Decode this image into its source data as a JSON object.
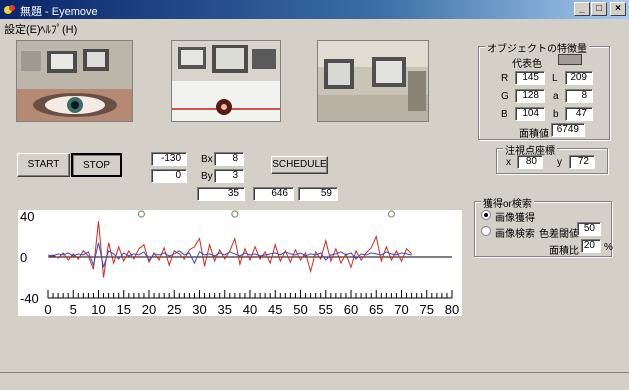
{
  "window": {
    "title": "無題 - Eyemove",
    "minimize": "_",
    "restore": "□",
    "close": "×"
  },
  "menu": [
    "設定(E)",
    "ﾍﾙﾌﾟ(H)"
  ],
  "controls": {
    "start_label": "START",
    "stop_label": "STOP",
    "schedule_label": "SCHEDULE",
    "field_a": "-130",
    "field_b": "0",
    "bx_label": "Bx",
    "bx_value": "8",
    "by_label": "By",
    "by_value": "3",
    "row_values": [
      "35",
      "646",
      "59"
    ]
  },
  "features": {
    "legend": "オブジェクトの特徴量",
    "rep_color_label": "代表色",
    "rep_color": "#a39d96",
    "rows": [
      {
        "k1": "R",
        "v1": "145",
        "k2": "L",
        "v2": "209"
      },
      {
        "k1": "G",
        "v1": "128",
        "k2": "a",
        "v2": "8"
      },
      {
        "k1": "B",
        "v1": "104",
        "k2": "b",
        "v2": "47"
      }
    ],
    "area_label": "面積値",
    "area_value": "6749"
  },
  "gaze": {
    "legend": "注視点座標",
    "x_label": "x",
    "x_value": "80",
    "y_label": "y",
    "y_value": "72"
  },
  "acquire": {
    "legend": "獲得or検索",
    "opt_acquire": "画像獲得",
    "opt_search": "画像検索",
    "threshold_label": "色差閾値",
    "threshold_value": "50",
    "ratio_label": "面積比",
    "ratio_value": "20",
    "ratio_unit": "%",
    "selected": "画像獲得"
  },
  "colors": {
    "red_series": "#d42a1a",
    "blue_series": "#3a48c8",
    "marker": "#6f9f6a"
  },
  "chart_data": {
    "type": "line",
    "title": "",
    "xlabel": "",
    "ylabel": "",
    "xlim": [
      0,
      80
    ],
    "ylim": [
      -40,
      40
    ],
    "y_ticks": [
      "40",
      "0",
      "-40"
    ],
    "x_ticks": [
      "0",
      "5",
      "10",
      "15",
      "20",
      "25",
      "30",
      "35",
      "40",
      "45",
      "50",
      "55",
      "60",
      "65",
      "70",
      "75",
      "80"
    ],
    "grid": false,
    "markers_x": [
      18.5,
      37,
      68
    ],
    "series": [
      {
        "color": "red",
        "x": [
          0,
          1,
          2,
          3,
          4,
          5,
          6,
          7,
          8,
          9,
          10,
          11,
          12,
          13,
          14,
          15,
          16,
          17,
          18,
          19,
          20,
          21,
          22,
          23,
          24,
          25,
          26,
          27,
          28,
          29,
          30,
          31,
          32,
          33,
          34,
          35,
          36,
          37,
          38,
          39,
          40,
          41,
          42,
          43,
          44,
          45,
          46,
          47,
          48,
          49,
          50,
          51,
          52,
          53,
          54,
          55,
          56,
          57,
          58,
          59,
          60,
          61,
          62,
          63,
          64,
          65,
          66,
          67,
          68,
          69,
          70,
          71,
          72
        ],
        "values": [
          0,
          2,
          -1,
          4,
          -3,
          3,
          -2,
          6,
          1,
          -12,
          35,
          -20,
          14,
          -6,
          10,
          -4,
          6,
          -2,
          8,
          12,
          -5,
          4,
          -3,
          9,
          -8,
          6,
          3,
          -2,
          7,
          10,
          18,
          -9,
          12,
          -4,
          7,
          -2,
          6,
          18,
          -7,
          8,
          -3,
          10,
          -2,
          5,
          -6,
          12,
          -4,
          6,
          -5,
          7,
          -3,
          4,
          -14,
          5,
          -2,
          16,
          -4,
          8,
          -6,
          3,
          -10,
          6,
          -3,
          4,
          9,
          20,
          -4,
          10,
          -3,
          6,
          -4,
          8,
          3
        ]
      },
      {
        "color": "blue",
        "x": [
          0,
          1,
          2,
          3,
          4,
          5,
          6,
          7,
          8,
          9,
          10,
          11,
          12,
          13,
          14,
          15,
          16,
          17,
          18,
          19,
          20,
          21,
          22,
          23,
          24,
          25,
          26,
          27,
          28,
          29,
          30,
          31,
          32,
          33,
          34,
          35,
          36,
          37,
          38,
          39,
          40,
          41,
          42,
          43,
          44,
          45,
          46,
          47,
          48,
          49,
          50,
          51,
          52,
          53,
          54,
          55,
          56,
          57,
          58,
          59,
          60,
          61,
          62,
          63,
          64,
          65,
          66,
          67,
          68,
          69,
          70,
          71,
          72
        ],
        "values": [
          2,
          1,
          3,
          2,
          4,
          1,
          3,
          2,
          5,
          -8,
          14,
          -10,
          6,
          3,
          -2,
          4,
          1,
          3,
          2,
          5,
          -3,
          3,
          2,
          4,
          1,
          3,
          6,
          2,
          4,
          -6,
          5,
          2,
          3,
          1,
          4,
          2,
          5,
          3,
          1,
          4,
          2,
          3,
          1,
          2,
          3,
          4,
          2,
          5,
          3,
          2,
          4,
          1,
          3,
          2,
          4,
          -3,
          2,
          3,
          5,
          2,
          4,
          -2,
          3,
          2,
          4,
          3,
          2,
          5,
          3,
          2,
          4,
          3,
          2
        ]
      }
    ]
  }
}
